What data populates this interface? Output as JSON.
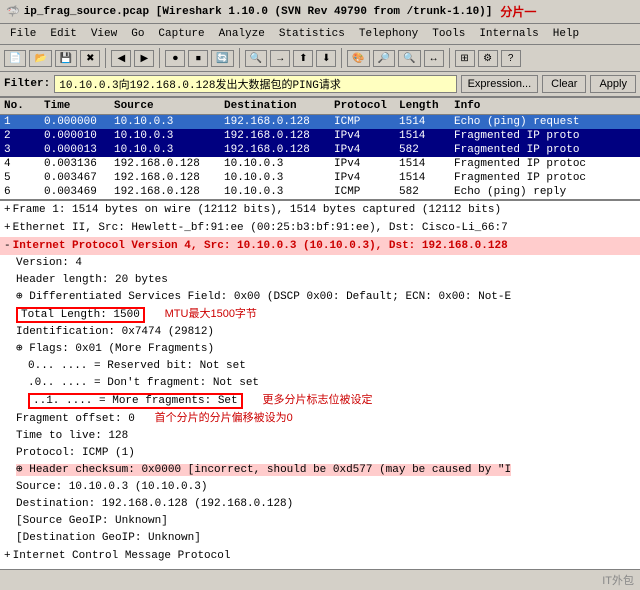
{
  "title": "ip_frag_source.pcap [Wireshark 1.10.0 (SVN Rev 49790 from /trunk-1.10)]",
  "tab_indicator": "分片一",
  "menu": {
    "items": [
      "File",
      "Edit",
      "View",
      "Go",
      "Capture",
      "Analyze",
      "Statistics",
      "Telephony",
      "Tools",
      "Internals",
      "Help"
    ]
  },
  "filter": {
    "label": "Filter:",
    "value": "10.10.0.3向192.168.0.128发出大数据包的PING请求",
    "expression_label": "Expression...",
    "clear_label": "Clear",
    "apply_label": "Apply"
  },
  "packet_list": {
    "headers": [
      "No.",
      "Time",
      "Source",
      "Destination",
      "Protocol",
      "Length",
      "Info"
    ],
    "rows": [
      {
        "no": "1",
        "time": "0.000000",
        "src": "10.10.0.3",
        "dst": "192.168.0.128",
        "proto": "ICMP",
        "len": "1514",
        "info": "Echo (ping) request",
        "style": "selected-blue"
      },
      {
        "no": "2",
        "time": "0.000010",
        "src": "10.10.0.3",
        "dst": "192.168.0.128",
        "proto": "IPv4",
        "len": "1514",
        "info": "Fragmented IP proto",
        "style": "selected-dark"
      },
      {
        "no": "3",
        "time": "0.000013",
        "src": "10.10.0.3",
        "dst": "192.168.0.128",
        "proto": "IPv4",
        "len": "582",
        "info": "Fragmented IP proto",
        "style": "selected-dark"
      },
      {
        "no": "4",
        "time": "0.003136",
        "src": "192.168.0.128",
        "dst": "10.10.0.3",
        "proto": "IPv4",
        "len": "1514",
        "info": "Fragmented IP protoc",
        "style": "row-normal"
      },
      {
        "no": "5",
        "time": "0.003467",
        "src": "192.168.0.128",
        "dst": "10.10.0.3",
        "proto": "IPv4",
        "len": "1514",
        "info": "Fragmented IP protoc",
        "style": "row-normal"
      },
      {
        "no": "6",
        "time": "0.003469",
        "src": "192.168.0.128",
        "dst": "10.10.0.3",
        "proto": "ICMP",
        "len": "582",
        "info": "Echo (ping) reply",
        "style": "row-normal"
      }
    ]
  },
  "detail": {
    "sections": [
      {
        "id": "frame",
        "expanded": false,
        "text": "Frame 1: 1514 bytes on wire (12112 bits), 1514 bytes captured (12112 bits)",
        "prefix": "+"
      },
      {
        "id": "ethernet",
        "expanded": false,
        "text": "Ethernet II, Src: Hewlett-_bf:91:ee (00:25:b3:bf:91:ee), Dst: Cisco-Li_66:7",
        "prefix": "+"
      },
      {
        "id": "ip",
        "expanded": true,
        "text": "Internet Protocol Version 4, Src: 10.10.0.3 (10.10.0.3), Dst: 192.168.0.128",
        "prefix": "-",
        "highlight": true,
        "children": [
          {
            "text": "Version: 4"
          },
          {
            "text": "Header length: 20 bytes"
          },
          {
            "text": "⊕ Differentiated Services Field: 0x00 (DSCP 0x00: Default; ECN: 0x00: Not-E",
            "expandable": true
          },
          {
            "text": "Total Length: 1500",
            "highlight_box": true,
            "annotation": "MTU最大1500字节"
          },
          {
            "text": "Identification: 0x7474 (29812)"
          },
          {
            "text": "⊕ Flags: 0x01 (More Fragments)",
            "expandable": true,
            "subchildren": [
              {
                "text": "0... .... = Reserved bit: Not set"
              },
              {
                "text": ".0.. .... = Don't fragment: Not set"
              },
              {
                "text": "..1. .... = More fragments: Set",
                "highlight_box": true,
                "annotation": "更多分片标志位被设定"
              }
            ]
          },
          {
            "text": "Fragment offset: 0",
            "annotation": "首个分片的分片偏移被设为0"
          },
          {
            "text": "Time to live: 128"
          },
          {
            "text": "Protocol: ICMP (1)"
          },
          {
            "text": "⊕ Header checksum: 0x0000 [incorrect, should be 0xd577 (may be caused by \"I",
            "highlight": true,
            "expandable": true
          }
        ]
      },
      {
        "id": "ip_addresses",
        "expanded": false,
        "text": "",
        "prefix": "",
        "lines": [
          "Source: 10.10.0.3 (10.10.0.3)",
          "Destination: 192.168.0.128 (192.168.0.128)",
          "[Source GeoIP: Unknown]",
          "[Destination GeoIP: Unknown]"
        ]
      },
      {
        "id": "icmp",
        "expanded": false,
        "text": "Internet Control Message Protocol",
        "prefix": "+"
      }
    ]
  },
  "status": {
    "text": "",
    "watermark": "IT外包"
  }
}
